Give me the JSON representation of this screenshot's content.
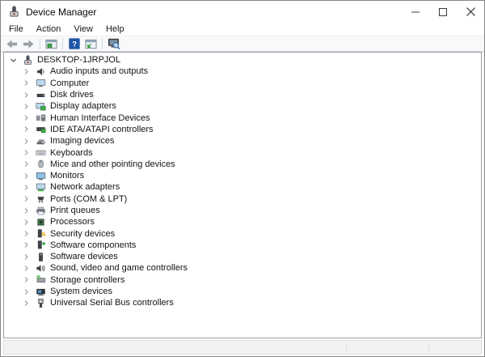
{
  "window": {
    "title": "Device Manager",
    "controls": {
      "minimize": "minimize",
      "maximize": "maximize",
      "close": "close"
    }
  },
  "menu": {
    "items": [
      "File",
      "Action",
      "View",
      "Help"
    ]
  },
  "toolbar": {
    "icons": [
      "back-arrow",
      "forward-arrow",
      "show-console-tree-window",
      "help-question-mark",
      "properties-window",
      "scan-for-hardware-changes"
    ]
  },
  "tree": {
    "root": {
      "label": "DESKTOP-1JRPJOL",
      "icon": "#i-pc",
      "expanded": true
    },
    "items": [
      {
        "label": "Audio inputs and outputs",
        "icon": "#i-speaker",
        "icon_name": "speaker-icon"
      },
      {
        "label": "Computer",
        "icon": "#i-monitor",
        "icon_name": "computer-monitor-icon"
      },
      {
        "label": "Disk drives",
        "icon": "#i-disk",
        "icon_name": "hard-disk-icon"
      },
      {
        "label": "Display adapters",
        "icon": "#i-display",
        "icon_name": "display-adapter-icon"
      },
      {
        "label": "Human Interface Devices",
        "icon": "#i-hid",
        "icon_name": "hid-icon"
      },
      {
        "label": "IDE ATA/ATAPI controllers",
        "icon": "#i-ide",
        "icon_name": "ide-controller-icon"
      },
      {
        "label": "Imaging devices",
        "icon": "#i-imaging",
        "icon_name": "imaging-device-icon"
      },
      {
        "label": "Keyboards",
        "icon": "#i-keyboard",
        "icon_name": "keyboard-icon"
      },
      {
        "label": "Mice and other pointing devices",
        "icon": "#i-mouse",
        "icon_name": "mouse-icon"
      },
      {
        "label": "Monitors",
        "icon": "#i-monitor2",
        "icon_name": "monitors-icon"
      },
      {
        "label": "Network adapters",
        "icon": "#i-network",
        "icon_name": "network-adapter-icon"
      },
      {
        "label": "Ports (COM & LPT)",
        "icon": "#i-port",
        "icon_name": "serial-port-icon"
      },
      {
        "label": "Print queues",
        "icon": "#i-printer",
        "icon_name": "printer-icon"
      },
      {
        "label": "Processors",
        "icon": "#i-cpu",
        "icon_name": "processor-icon"
      },
      {
        "label": "Security devices",
        "icon": "#i-security",
        "icon_name": "security-device-icon"
      },
      {
        "label": "Software components",
        "icon": "#i-swcomp",
        "icon_name": "software-component-icon"
      },
      {
        "label": "Software devices",
        "icon": "#i-swdev",
        "icon_name": "software-device-icon"
      },
      {
        "label": "Sound, video and game controllers",
        "icon": "#i-sound",
        "icon_name": "sound-controller-icon"
      },
      {
        "label": "Storage controllers",
        "icon": "#i-storage",
        "icon_name": "storage-controller-icon"
      },
      {
        "label": "System devices",
        "icon": "#i-sysdev",
        "icon_name": "system-device-icon"
      },
      {
        "label": "Universal Serial Bus controllers",
        "icon": "#i-usb",
        "icon_name": "usb-icon"
      }
    ]
  },
  "colors": {
    "help_blue": "#1d56a5",
    "accent_green": "#3fae49",
    "key_yellow": "#f0b429",
    "screen_blue": "#bcd9ef",
    "toolbar_bg": "#f8f9fa",
    "status_bg": "#f1f2f3"
  }
}
